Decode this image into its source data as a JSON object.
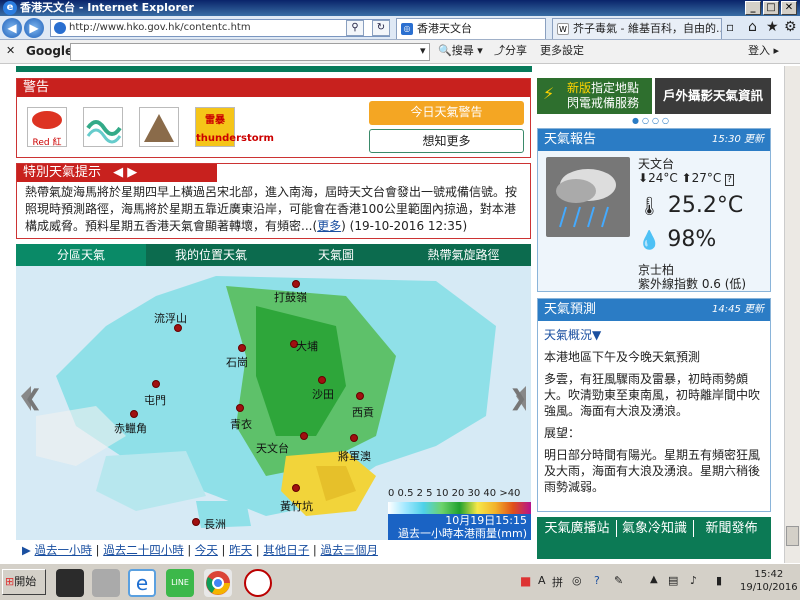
{
  "window": {
    "title": "香港天文台 - Internet Explorer"
  },
  "address": {
    "url": "http://www.hko.gov.hk/contentc.htm"
  },
  "tabs": [
    {
      "label": "香港天文台",
      "active": true
    },
    {
      "label": "芥子毒氣 - 維基百科，自由的...",
      "active": false
    }
  ],
  "toolbar": {
    "brand": "Google",
    "search_label": "搜尋",
    "share_label": "分享",
    "settings_label": "更多設定",
    "login_label": "登入"
  },
  "warning": {
    "title": "警告",
    "icons": [
      {
        "name": "red-rainstorm",
        "text": "Red 紅"
      },
      {
        "name": "fire-danger",
        "text": ""
      },
      {
        "name": "landslip",
        "text": ""
      },
      {
        "name": "thunderstorm",
        "text": "雷暴 thunderstorm"
      }
    ],
    "today_button": "今日天氣警告",
    "more_button": "想知更多"
  },
  "tips": {
    "title": "特別天氣提示",
    "body": "熱帶氣旋海馬將於星期四早上橫過呂宋北部，進入南海，屆時天文台會發出一號戒備信號。按照現時預測路徑，海馬將於星期五靠近廣東沿岸，可能會在香港100公里範圍內掠過，對本港構成威脅。預料星期五香港天氣會顯著轉壞，有頻密...",
    "more_link": "更多",
    "date": "(19-10-2016 12:35)"
  },
  "map_tabs": [
    "分區天氣",
    "我的位置天氣",
    "天氣圖",
    "熱帶氣旋路徑"
  ],
  "stations": [
    "打鼓嶺",
    "流浮山",
    "大埔",
    "石崗",
    "沙田",
    "屯門",
    "西貢",
    "赤鱲角",
    "青衣",
    "天文台",
    "將軍澳",
    "黃竹坑",
    "長洲"
  ],
  "legend": {
    "scale": "0 0.5 2 5 10 20 30 40 >40",
    "date": "10月19日15:15",
    "caption": "過去一小時本港雨量(mm)"
  },
  "history_links": [
    "過去一小時",
    "過去二十四小時",
    "今天",
    "昨天",
    "其他日子",
    "過去三個月"
  ],
  "banners": [
    {
      "tag": "新版",
      "text": "指定地點閃電戒備服務"
    },
    {
      "text": "戶外攝影天氣資訊"
    }
  ],
  "report": {
    "title": "天氣報告",
    "time": "15:30",
    "update_label": "更新",
    "station": "天文台",
    "min": "24°C",
    "max": "27°C",
    "temp": "25.2°C",
    "humidity": "98%",
    "uv_station": "京士柏",
    "uv": "紫外線指數 0.6 (低)"
  },
  "forecast": {
    "title": "天氣預測",
    "time": "14:45",
    "update_label": "更新",
    "overview_link": "天氣概況▼",
    "section1": "本港地區下午及今晚天氣預測",
    "para1": "多雲，有狂風驟雨及雷暴，初時雨勢頗大。吹清勁東至東南風，初時離岸間中吹強風。海面有大浪及湧浪。",
    "section2": "展望：",
    "para2": "明日部分時間有陽光。星期五有頻密狂風及大雨，海面有大浪及湧浪。星期六稍後雨勢減弱。"
  },
  "bottom_tabs": [
    "天氣廣播站",
    "氣象冷知識",
    "新聞發佈"
  ],
  "taskbar": {
    "start": "開始",
    "time": "15:42",
    "date": "19/10/2016"
  },
  "colors": {
    "red": "#c8211e",
    "green": "#0c6b4e",
    "blue": "#2b7cc5"
  }
}
